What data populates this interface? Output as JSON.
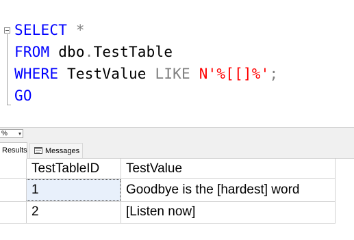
{
  "editor": {
    "lines": [
      {
        "parts": [
          {
            "t": "SELECT",
            "c": "kw"
          },
          {
            "t": " ",
            "c": "plain"
          },
          {
            "t": "*",
            "c": "gray"
          }
        ]
      },
      {
        "parts": [
          {
            "t": "FROM",
            "c": "kw"
          },
          {
            "t": " dbo",
            "c": "plain"
          },
          {
            "t": ".",
            "c": "gray"
          },
          {
            "t": "TestTable",
            "c": "plain"
          }
        ]
      },
      {
        "parts": [
          {
            "t": "WHERE",
            "c": "kw"
          },
          {
            "t": " TestValue ",
            "c": "plain"
          },
          {
            "t": "LIKE",
            "c": "gray"
          },
          {
            "t": " ",
            "c": "plain"
          },
          {
            "t": "N'%[[]%'",
            "c": "red"
          },
          {
            "t": ";",
            "c": "gray"
          }
        ]
      },
      {
        "parts": [
          {
            "t": "GO",
            "c": "kw"
          }
        ]
      }
    ]
  },
  "zoom": {
    "value": "%",
    "arrow": "▾"
  },
  "tabs": {
    "results_label": "Results",
    "messages_label": "Messages"
  },
  "grid": {
    "columns": [
      "TestTableID",
      "TestValue"
    ],
    "rows": [
      {
        "num": "",
        "TestTableID": "1",
        "TestValue": "Goodbye is the [hardest] word"
      },
      {
        "num": "",
        "TestTableID": "2",
        "TestValue": "[Listen now]"
      }
    ]
  },
  "colors": {
    "keyword": "#0000ff",
    "operator": "#808080",
    "string": "#ff0000"
  }
}
